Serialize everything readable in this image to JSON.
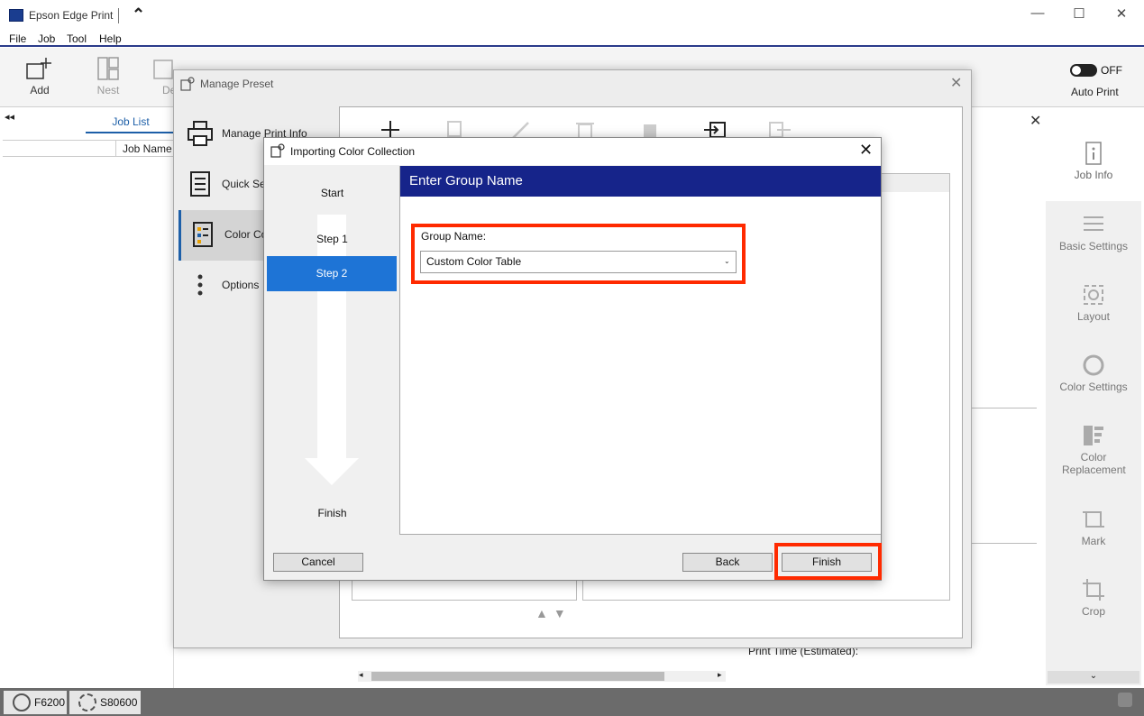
{
  "app": {
    "title": "Epson Edge Print"
  },
  "menu": [
    "File",
    "Job",
    "Tool",
    "Help"
  ],
  "toolbar": {
    "add_label": "Add",
    "nest_label": "Nest",
    "delete_label_partial": "De",
    "autoprint_toggle_state": "OFF",
    "autoprint_label": "Auto Print"
  },
  "joblist": {
    "tab_label": "Job List",
    "column_jobname": "Job Name"
  },
  "right_panel": {
    "items": [
      {
        "label": "Job Info",
        "icon": "info-icon"
      },
      {
        "label": "Basic Settings",
        "icon": "list-icon"
      },
      {
        "label": "Layout",
        "icon": "layout-icon"
      },
      {
        "label": "Color Settings",
        "icon": "ring-icon"
      },
      {
        "label": "Color Replacement",
        "icon": "palette-icon"
      },
      {
        "label": "Mark",
        "icon": "crop-marks-icon"
      },
      {
        "label": "Crop",
        "icon": "crop-icon"
      }
    ]
  },
  "main": {
    "print_time_label": "Print Time (Estimated):"
  },
  "status": {
    "printer1": "F6200",
    "printer2": "S80600"
  },
  "manage_preset": {
    "title": "Manage Preset",
    "nav": [
      {
        "label": "Manage Print Info",
        "icon": "printer-icon"
      },
      {
        "label": "Quick Se",
        "icon": "quick-settings-icon"
      },
      {
        "label": "Color Co",
        "icon": "color-collection-icon"
      },
      {
        "label": "Options",
        "icon": "more-vertical-icon"
      }
    ]
  },
  "import_dialog": {
    "title": "Importing Color Collection",
    "steps": {
      "start": "Start",
      "step1": "Step 1",
      "step2": "Step 2",
      "finish": "Finish"
    },
    "header": "Enter Group Name",
    "group_label": "Group Name:",
    "group_value": "Custom Color Table",
    "buttons": {
      "cancel": "Cancel",
      "back": "Back",
      "finish": "Finish"
    },
    "highlight_color": "#ff2a00",
    "header_color": "#16248a",
    "active_step_color": "#1e74d6"
  }
}
